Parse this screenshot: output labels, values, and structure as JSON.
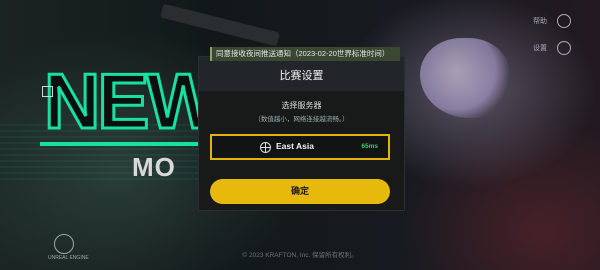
{
  "banner": {
    "notification": "同意接收夜间推送通知（2023-02-20世界标准时间）"
  },
  "background": {
    "logo_text": "NEW",
    "mode_text": "MO"
  },
  "top_right": {
    "help_label": "帮助",
    "settings_label": "设置"
  },
  "dialog": {
    "title": "比赛设置",
    "section_title": "选择服务器",
    "section_subtitle": "（数值越小，网络连接越流畅。）",
    "server": {
      "name": "East Asia",
      "ping": "65ms",
      "icon": "globe-icon",
      "highlight_color": "#e3b509",
      "ping_color": "#38d46b"
    },
    "confirm_label": "确定",
    "confirm_color": "#e8b90d"
  },
  "footer": {
    "copyright": "© 2023 KRAFTON, Inc. 保留所有权利。",
    "engine_logo": "UNREAL ENGINE"
  }
}
